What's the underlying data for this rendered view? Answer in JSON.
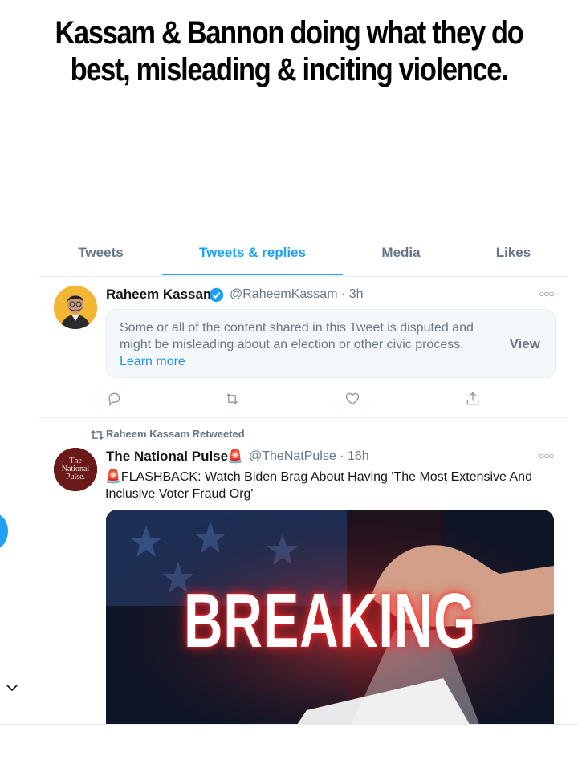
{
  "caption": {
    "line1": "Kassam & Bannon doing what they do",
    "line2": "best, misleading & inciting violence."
  },
  "tabs": [
    {
      "label": "Tweets",
      "active": false
    },
    {
      "label": "Tweets & replies",
      "active": true
    },
    {
      "label": "Media",
      "active": false
    },
    {
      "label": "Likes",
      "active": false
    }
  ],
  "tweet1": {
    "name": "Raheem Kassam",
    "verified": true,
    "handle_time": "@RaheemKassam · 3h",
    "more_icon": "more-dots-icon",
    "notice": {
      "text": "Some or all of the content shared in this Tweet is disputed and might be misleading about an election or other civic process.",
      "link": "Learn more",
      "action": "View"
    },
    "actions": [
      "reply-icon",
      "retweet-icon",
      "like-icon",
      "share-icon"
    ]
  },
  "tweet2": {
    "retweet_label": "Raheem Kassam Retweeted",
    "name": "The National Pulse",
    "name_emoji": "🚨",
    "handle_time": "@TheNatPulse · 16h",
    "avatar_text": "The National Pulse.",
    "body_emoji": "🚨",
    "body": "FLASHBACK: Watch Biden Brag About Having 'The Most Extensive And Inclusive Voter Fraud Org'",
    "media_text": "BREAKING"
  },
  "colors": {
    "accent": "#1da1f2",
    "muted": "#657786",
    "border": "#e6ecf0"
  }
}
